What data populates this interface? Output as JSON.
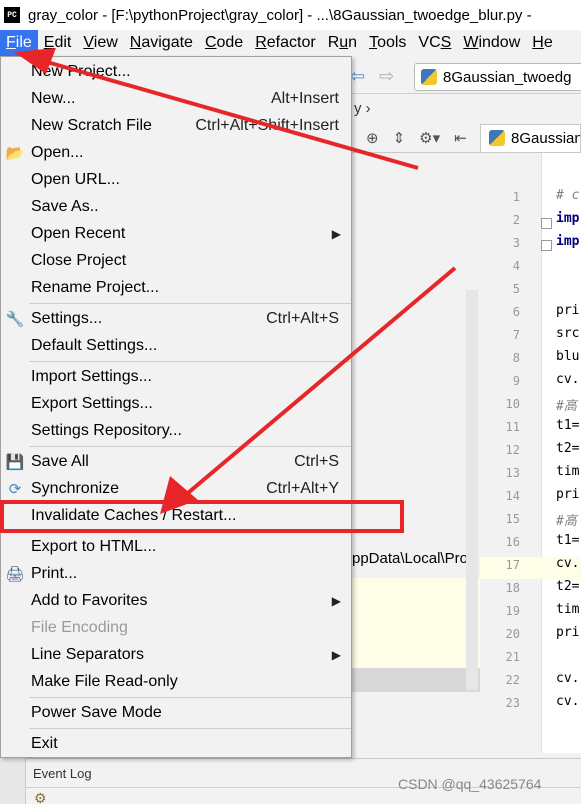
{
  "window": {
    "app_icon_text": "PC",
    "title": "gray_color - [F:\\pythonProject\\gray_color] - ...\\8Gaussian_twoedge_blur.py - "
  },
  "menubar": [
    {
      "label": "File",
      "u": "F",
      "rest": "ile",
      "active": true
    },
    {
      "label": "Edit",
      "u": "E",
      "rest": "dit"
    },
    {
      "label": "View",
      "u": "V",
      "rest": "iew"
    },
    {
      "label": "Navigate",
      "u": "N",
      "rest": "avigate"
    },
    {
      "label": "Code",
      "u": "C",
      "rest": "ode"
    },
    {
      "label": "Refactor",
      "u": "R",
      "rest": "efactor"
    },
    {
      "label": "Run",
      "pre": "R",
      "u": "u",
      "rest": "n"
    },
    {
      "label": "Tools",
      "u": "T",
      "rest": "ools"
    },
    {
      "label": "VCS",
      "pre": "VC",
      "u": "S",
      "rest": ""
    },
    {
      "label": "Window",
      "u": "W",
      "rest": "indow"
    },
    {
      "label": "He",
      "u": "H",
      "rest": "e"
    }
  ],
  "nav": {
    "file_tab": "8Gaussian_twoedg",
    "breadcrumb_tail": "y",
    "editor_tab": "8Gaussian"
  },
  "project": {
    "path_fragment": "ppData\\Local\\Prog"
  },
  "editor": {
    "line_numbers": [
      "1",
      "2",
      "3",
      "4",
      "5",
      "6",
      "7",
      "8",
      "9",
      "10",
      "11",
      "12",
      "13",
      "14",
      "15",
      "16",
      "17",
      "18",
      "19",
      "20",
      "21",
      "22",
      "23"
    ],
    "lines": [
      "# c",
      "imp",
      "imp",
      "",
      "",
      "pri",
      "src",
      "blu",
      "cv.",
      "#高",
      "t1=",
      "t2=",
      "tim",
      "pri",
      "#高",
      "t1=",
      "cv.",
      "t2=",
      "tim",
      "pri",
      "",
      "cv.",
      "cv."
    ]
  },
  "file_menu": {
    "items": [
      {
        "type": "item",
        "label": "New Project...",
        "name": "new-project"
      },
      {
        "type": "item",
        "label": "New...",
        "shortcut": "Alt+Insert",
        "name": "new"
      },
      {
        "type": "item",
        "label": "New Scratch File",
        "shortcut": "Ctrl+Alt+Shift+Insert",
        "name": "new-scratch-file"
      },
      {
        "type": "item",
        "label": "Open...",
        "icon": "folder-icon",
        "name": "open"
      },
      {
        "type": "item",
        "label": "Open URL...",
        "name": "open-url"
      },
      {
        "type": "item",
        "label": "Save As..",
        "name": "save-as"
      },
      {
        "type": "item",
        "label": "Open Recent",
        "submenu": true,
        "name": "open-recent"
      },
      {
        "type": "item",
        "label": "Close Project",
        "name": "close-project"
      },
      {
        "type": "item",
        "label": "Rename Project...",
        "name": "rename-project"
      },
      {
        "type": "sep"
      },
      {
        "type": "item",
        "label": "Settings...",
        "shortcut": "Ctrl+Alt+S",
        "icon": "wrench-icon",
        "name": "settings"
      },
      {
        "type": "item",
        "label": "Default Settings...",
        "name": "default-settings"
      },
      {
        "type": "sep"
      },
      {
        "type": "item",
        "label": "Import Settings...",
        "name": "import-settings"
      },
      {
        "type": "item",
        "label": "Export Settings...",
        "name": "export-settings"
      },
      {
        "type": "item",
        "label": "Settings Repository...",
        "name": "settings-repository"
      },
      {
        "type": "sep"
      },
      {
        "type": "item",
        "label": "Save All",
        "shortcut": "Ctrl+S",
        "icon": "save-icon",
        "name": "save-all"
      },
      {
        "type": "item",
        "label": "Synchronize",
        "shortcut": "Ctrl+Alt+Y",
        "icon": "sync-icon",
        "name": "synchronize"
      },
      {
        "type": "item",
        "label": "Invalidate Caches / Restart...",
        "name": "invalidate-caches-restart"
      },
      {
        "type": "sep"
      },
      {
        "type": "item",
        "label": "Export to HTML...",
        "name": "export-to-html"
      },
      {
        "type": "item",
        "label": "Print...",
        "icon": "print-icon",
        "name": "print"
      },
      {
        "type": "item",
        "label": "Add to Favorites",
        "submenu": true,
        "name": "add-to-favorites"
      },
      {
        "type": "item",
        "label": "File Encoding",
        "disabled": true,
        "name": "file-encoding"
      },
      {
        "type": "item",
        "label": "Line Separators",
        "submenu": true,
        "name": "line-separators"
      },
      {
        "type": "item",
        "label": "Make File Read-only",
        "name": "make-file-read-only"
      },
      {
        "type": "sep"
      },
      {
        "type": "item",
        "label": "Power Save Mode",
        "name": "power-save-mode"
      },
      {
        "type": "sep"
      },
      {
        "type": "item",
        "label": "Exit",
        "name": "exit"
      }
    ]
  },
  "bottom": {
    "event_log": "Event Log",
    "watermark": "CSDN @qq_43625764"
  },
  "annotation": {
    "highlight_color": "#e8262a"
  }
}
